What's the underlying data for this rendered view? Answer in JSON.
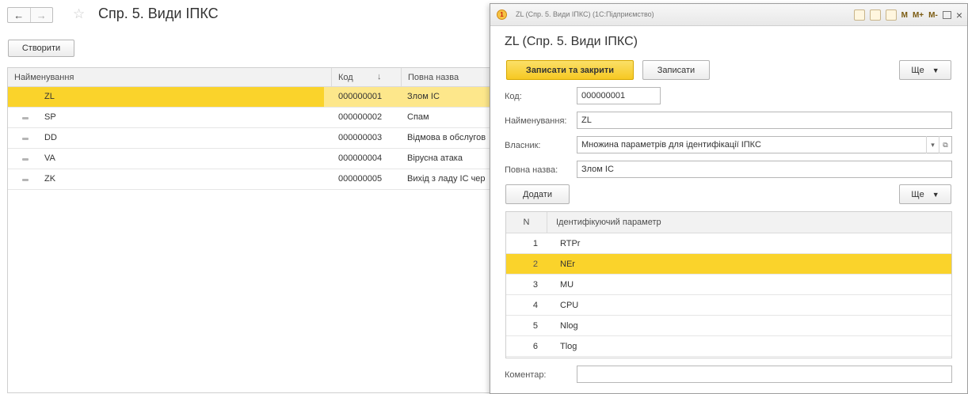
{
  "main": {
    "nav": {
      "back": "←",
      "forward": "→"
    },
    "title": "Спр. 5. Види ІПКС",
    "create_label": "Створити",
    "columns": {
      "name": "Найменування",
      "code": "Код",
      "sort_arrow": "↓",
      "full": "Повна назва"
    },
    "rows": [
      {
        "name": "ZL",
        "code": "000000001",
        "full": "Злом ІС"
      },
      {
        "name": "SP",
        "code": "000000002",
        "full": "Спам"
      },
      {
        "name": "DD",
        "code": "000000003",
        "full": "Відмова в обслугов"
      },
      {
        "name": "VA",
        "code": "000000004",
        "full": "Вірусна атака"
      },
      {
        "name": "ZK",
        "code": "000000005",
        "full": "Вихід з ладу ІС чер"
      }
    ]
  },
  "dialog": {
    "caption": "ZL (Спр. 5. Види ІПКС) (1С:Підприємство)",
    "toolbar": {
      "m": "M",
      "mplus": "M+",
      "mminus": "M-",
      "close": "×"
    },
    "heading": "ZL (Спр. 5. Види ІПКС)",
    "save_close_label": "Записати та закрити",
    "save_label": "Записати",
    "more_label": "Ще",
    "fields": {
      "code_label": "Код:",
      "code_value": "000000001",
      "name_label": "Найменування:",
      "name_value": "ZL",
      "owner_label": "Власник:",
      "owner_value": "Множина параметрів для ідентифікації ІПКС",
      "full_label": "Повна назва:",
      "full_value": "Злом ІС",
      "comment_label": "Коментар:",
      "comment_value": ""
    },
    "add_label": "Додати",
    "table": {
      "col_n": "N",
      "col_param": "Ідентифікуючий параметр",
      "rows": [
        {
          "n": "1",
          "param": "RTPr"
        },
        {
          "n": "2",
          "param": "NEr"
        },
        {
          "n": "3",
          "param": "MU"
        },
        {
          "n": "4",
          "param": "CPU"
        },
        {
          "n": "5",
          "param": "Nlog"
        },
        {
          "n": "6",
          "param": "Tlog"
        }
      ]
    }
  },
  "colors": {
    "selection": "#fad32b",
    "selection_light": "#fde78b",
    "primary_button": "#f6c822"
  }
}
